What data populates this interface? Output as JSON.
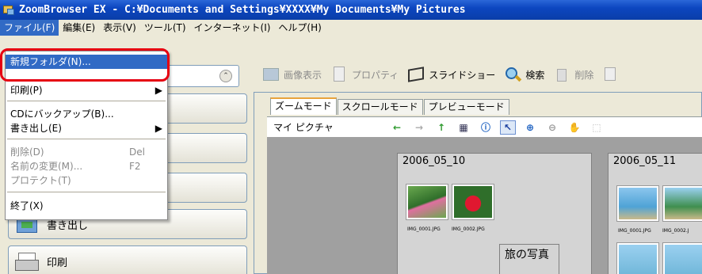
{
  "window": {
    "title": "ZoomBrowser EX  - C:¥Documents and Settings¥XXXX¥My Documents¥My Pictures"
  },
  "menubar": [
    "ファイル(F)",
    "編集(E)",
    "表示(V)",
    "ツール(T)",
    "インターネット(I)",
    "ヘルプ(H)"
  ],
  "file_menu": {
    "new_folder": "新規フォルダ(N)...",
    "print": "印刷(P)",
    "cd_backup": "CDにバックアップ(B)...",
    "export": "書き出し(E)",
    "delete": "削除(D)",
    "delete_shortcut": "Del",
    "rename": "名前の変更(M)...",
    "rename_shortcut": "F2",
    "protect": "プロテクト(T)",
    "exit": "終了(X)"
  },
  "left_nav": {
    "export_label": "書き出し",
    "print_label": "印刷"
  },
  "toolbar": {
    "view_image": "画像表示",
    "properties": "プロパティ",
    "slideshow": "スライドショー",
    "search": "検索",
    "delete": "削除"
  },
  "tabs": [
    "ズームモード",
    "スクロールモード",
    "プレビューモード"
  ],
  "location": "マイ ピクチャ",
  "folders": [
    {
      "name": "2006_05_10",
      "files": [
        "IMG_0001.JPG",
        "IMG_0002.JPG"
      ]
    },
    {
      "name": "2006_05_11",
      "files": [
        "IMG_0001.JPG",
        "IMG_0002.J"
      ]
    }
  ],
  "album": "旅の写真",
  "colors": {
    "title_bar": "#0c46c0",
    "menu_highlight": "#316ac5",
    "callout": "#e60012"
  }
}
